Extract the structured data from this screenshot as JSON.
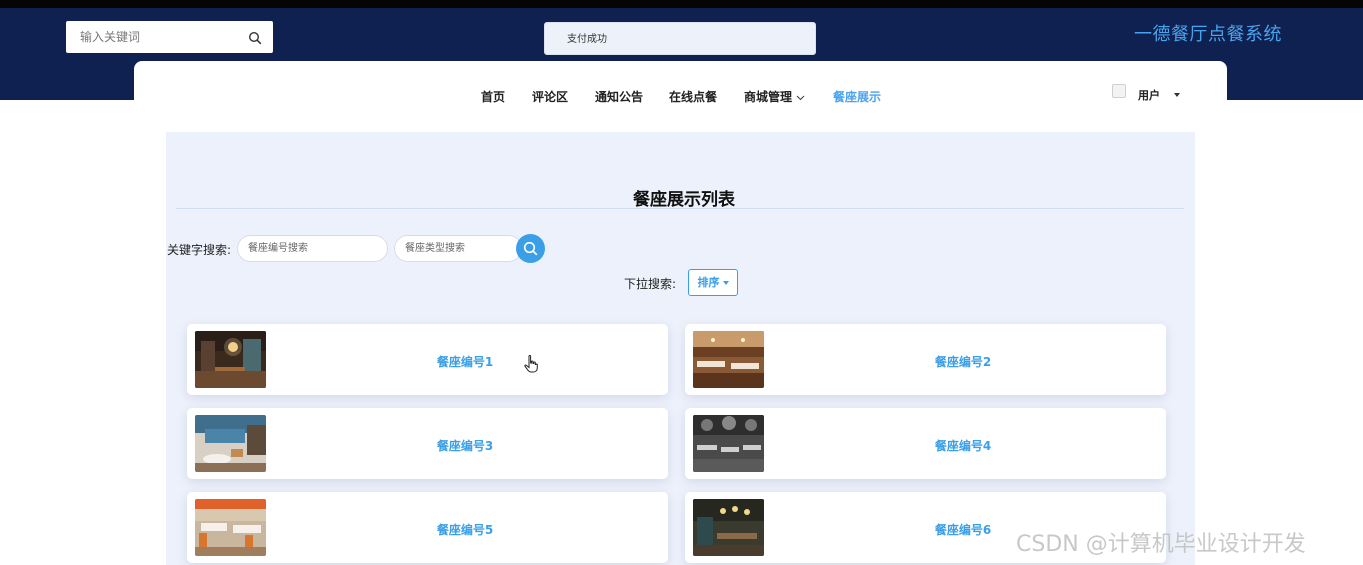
{
  "header": {
    "search_placeholder": "输入关键词",
    "toast": "支付成功",
    "site_title": "一德餐厅点餐系统"
  },
  "nav": {
    "items": [
      {
        "label": "首页"
      },
      {
        "label": "评论区"
      },
      {
        "label": "通知公告"
      },
      {
        "label": "在线点餐"
      },
      {
        "label": "商城管理"
      },
      {
        "label": "餐座展示"
      }
    ],
    "active": "餐座展示",
    "user_label": "用户"
  },
  "page": {
    "title": "餐座展示列表",
    "keyword_label": "关键字搜索:",
    "seat_no_placeholder": "餐座编号搜索",
    "seat_type_placeholder": "餐座类型搜索",
    "dropdown_label": "下拉搜索:",
    "sort_label": "排序"
  },
  "cards": [
    {
      "title": "餐座编号1"
    },
    {
      "title": "餐座编号2"
    },
    {
      "title": "餐座编号3"
    },
    {
      "title": "餐座编号4"
    },
    {
      "title": "餐座编号5"
    },
    {
      "title": "餐座编号6"
    }
  ],
  "watermark": "CSDN @计算机毕业设计开发",
  "colors": {
    "header_bg": "#0f2150",
    "accent": "#3b9fe8",
    "content_bg": "#edf1fb"
  }
}
